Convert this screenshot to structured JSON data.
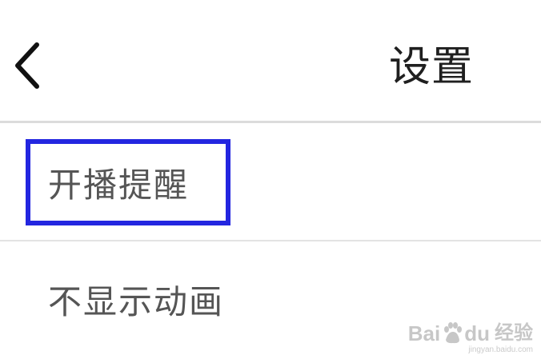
{
  "header": {
    "title": "设置",
    "back_icon": "chevron-left-icon"
  },
  "settings": {
    "items": [
      {
        "label": "开播提醒",
        "highlighted": true
      },
      {
        "label": "不显示动画",
        "highlighted": false
      }
    ]
  },
  "annotation": {
    "highlight_color": "#2326e0"
  },
  "watermark": {
    "brand_part1": "Bai",
    "brand_part2": "du",
    "product": "经验",
    "url": "jingyan.baidu.com"
  }
}
